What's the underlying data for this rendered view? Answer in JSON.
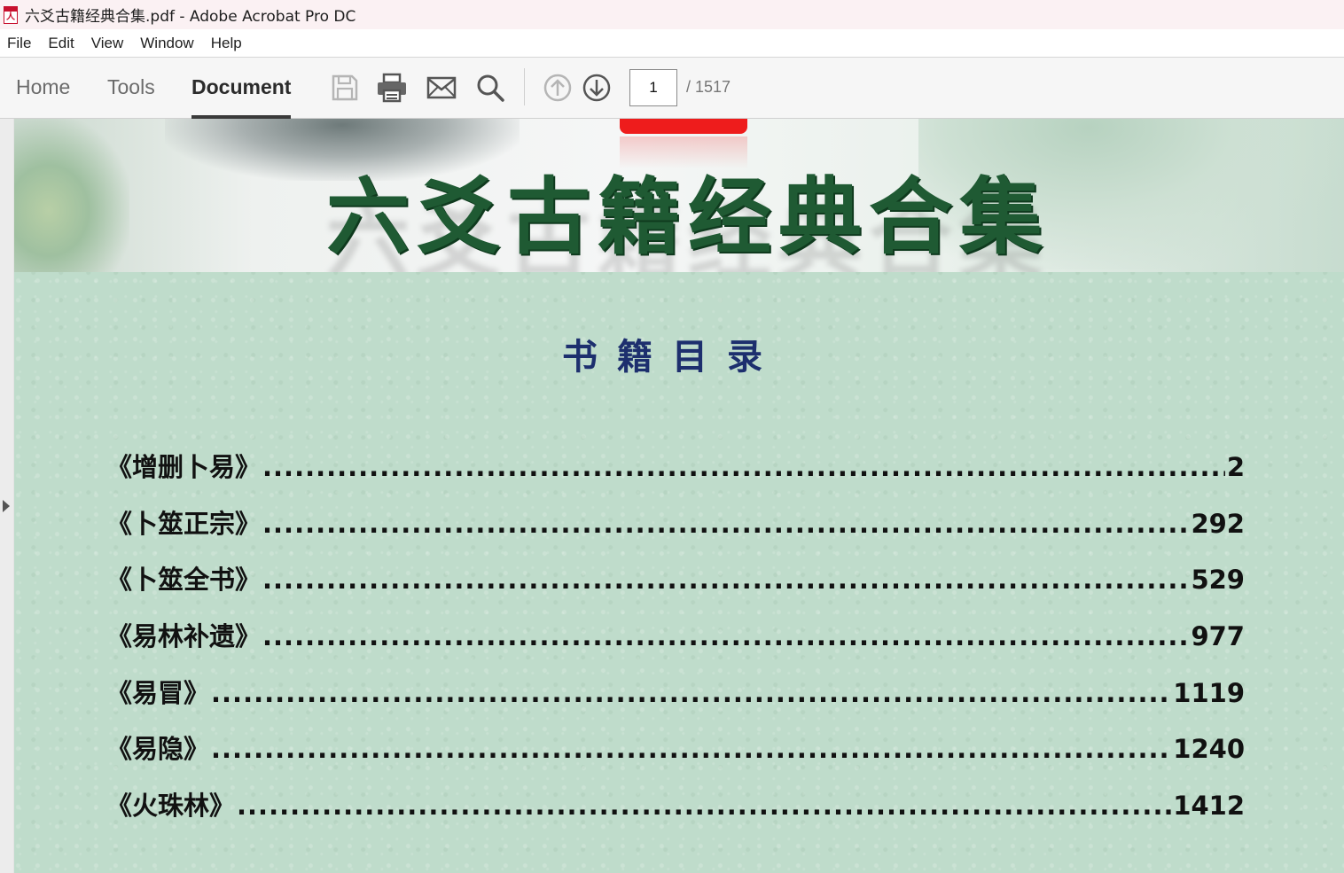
{
  "window": {
    "title": "六爻古籍经典合集.pdf - Adobe Acrobat Pro DC"
  },
  "menu": [
    "File",
    "Edit",
    "View",
    "Window",
    "Help"
  ],
  "tabs": {
    "home": "Home",
    "tools": "Tools",
    "document": "Document"
  },
  "navigation": {
    "current_page": "1",
    "total_pages": "/ 1517"
  },
  "document": {
    "banner_title": "六爻古籍经典合集",
    "toc_title": "书籍目录",
    "toc": [
      {
        "title": "《增删卜易》",
        "page": "2"
      },
      {
        "title": "《卜筮正宗》",
        "page": "292"
      },
      {
        "title": "《卜筮全书》",
        "page": "529"
      },
      {
        "title": "《易林补遗》",
        "page": "977"
      },
      {
        "title": "《易冒》",
        "page": "1119"
      },
      {
        "title": "《易隐》",
        "page": "1240"
      },
      {
        "title": "《火珠林》",
        "page": "1412"
      }
    ]
  },
  "colors": {
    "accent": "#1f5a33",
    "toc_heading": "#1d2f6e",
    "page_background": "#bfdccb",
    "seal_red": "#ee1c1c"
  }
}
